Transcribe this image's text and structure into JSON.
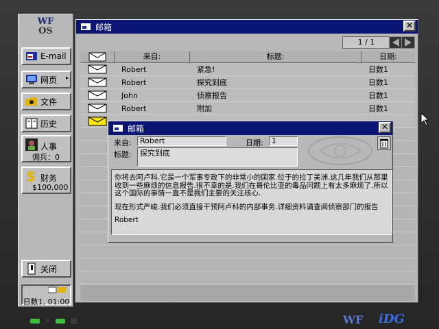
{
  "brand": {
    "logo_top": "WF",
    "logo_bottom": "OS",
    "footer_wf": "WF",
    "footer_idg": "iDG"
  },
  "sidebar": {
    "items": [
      {
        "label": "E-mail",
        "icon": "email-icon"
      },
      {
        "label": "网页",
        "icon": "web-icon"
      },
      {
        "label": "文件",
        "icon": "folder-icon"
      },
      {
        "label": "历史",
        "icon": "book-icon"
      },
      {
        "label": "人事",
        "icon": "person-icon",
        "sub": "佣兵：0"
      },
      {
        "label": "财务",
        "icon": "dollar-icon",
        "sub": "$100,000"
      }
    ],
    "close_label": "关闭",
    "status_text": "日数1, 01:00"
  },
  "mailbox": {
    "title": "邮箱",
    "page_indicator": "1 / 1",
    "columns": {
      "from": "来自:",
      "subject": "标题:",
      "date": "日期:"
    },
    "rows": [
      {
        "from": "Robert",
        "subject": "紧急!",
        "date": "日数1"
      },
      {
        "from": "Robert",
        "subject": "探究到底",
        "date": "日数1"
      },
      {
        "from": "John",
        "subject": "侦察报告",
        "date": "日数1"
      },
      {
        "from": "Robert",
        "subject": "附加",
        "date": "日数1"
      }
    ]
  },
  "message": {
    "title": "邮箱",
    "from_label": "来自:",
    "from_value": "Robert",
    "date_label": "日期:",
    "date_value": "1",
    "subject_label": "标题:",
    "subject_value": "探究到底",
    "paragraph1": "你将去阿卢科.它是一个军事专政下的非常小的国家.位于的拉丁美洲.这几年我们从那里收到一些麻烦的信息报告.很不幸的是.我们在哥伦比亚的毒品问题上有太多麻烦了.所以这个国际的事情一直不是我们主要的关注核心.",
    "paragraph2": "现在形式严峻.我们必须直接干预阿卢科的内部事务.详细资料请查阅侦察部门的报告",
    "signature": "Robert"
  }
}
